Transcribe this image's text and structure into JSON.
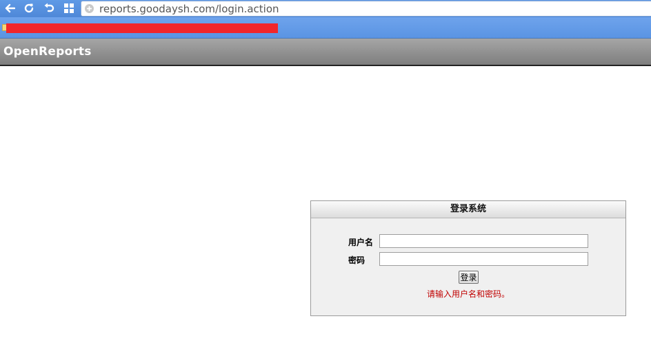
{
  "browser": {
    "url": "reports.goodaysh.com/login.action",
    "nav_icons": [
      "back-arrow-icon",
      "reload-icon",
      "undo-icon",
      "apps-grid-icon"
    ],
    "accent": "#5a94e3"
  },
  "app": {
    "title": "OpenReports",
    "header_color": "#8f8f8f"
  },
  "login": {
    "heading": "登录系统",
    "username_label": "用户名",
    "username_value": "",
    "password_label": "密码",
    "password_value": "",
    "submit_label": "登录",
    "message": "请输入用户名和密码。",
    "message_color": "#c00000"
  }
}
